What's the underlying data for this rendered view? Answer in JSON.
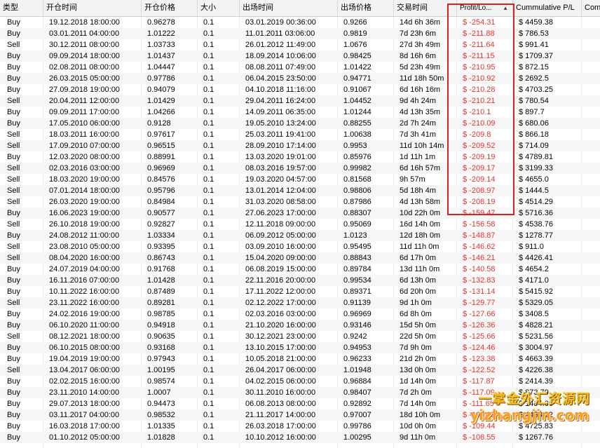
{
  "headers": [
    "类型",
    "开仓时间",
    "开仓价格",
    "大小",
    "出场时间",
    "出场价格",
    "交易时间",
    "Profit/Lo...",
    "Cummulative P/L",
    "Com"
  ],
  "rows": [
    [
      "Buy",
      "19.12.2018 18:00:00",
      "0.96278",
      "0.1",
      "03.01.2019 00:36:00",
      "0.9266",
      "14d 6h 36m",
      "$ -254.31",
      "$ 4459.38"
    ],
    [
      "Buy",
      "03.01.2011 04:00:00",
      "1.01222",
      "0.1",
      "11.01.2011 03:06:00",
      "0.9819",
      "7d 23h 6m",
      "$ -211.88",
      "$ 786.53"
    ],
    [
      "Sell",
      "30.12.2011 08:00:00",
      "1.03733",
      "0.1",
      "26.01.2012 11:49:00",
      "1.0676",
      "27d 3h 49m",
      "$ -211.64",
      "$ 991.41"
    ],
    [
      "Buy",
      "09.09.2014 18:00:00",
      "1.01437",
      "0.1",
      "18.09.2014 10:06:00",
      "0.98425",
      "8d 16h 6m",
      "$ -211.15",
      "$ 1709.37"
    ],
    [
      "Buy",
      "02.08.2011 08:00:00",
      "1.04447",
      "0.1",
      "08.08.2011 07:49:00",
      "1.01422",
      "5d 23h 49m",
      "$ -210.95",
      "$ 872.15"
    ],
    [
      "Buy",
      "26.03.2015 05:00:00",
      "0.97786",
      "0.1",
      "06.04.2015 23:50:00",
      "0.94771",
      "11d 18h 50m",
      "$ -210.92",
      "$ 2692.5"
    ],
    [
      "Buy",
      "27.09.2018 19:00:00",
      "0.94079",
      "0.1",
      "04.10.2018 11:16:00",
      "0.91067",
      "6d 16h 16m",
      "$ -210.28",
      "$ 4703.25"
    ],
    [
      "Sell",
      "20.04.2011 12:00:00",
      "1.01429",
      "0.1",
      "29.04.2011 16:24:00",
      "1.04452",
      "9d 4h 24m",
      "$ -210.21",
      "$ 780.54"
    ],
    [
      "Buy",
      "09.09.2011 17:00:00",
      "1.04266",
      "0.1",
      "14.09.2011 06:35:00",
      "1.01244",
      "4d 13h 35m",
      "$ -210.1",
      "$ 897.7"
    ],
    [
      "Buy",
      "17.05.2010 06:00:00",
      "0.9128",
      "0.1",
      "19.05.2010 13:24:00",
      "0.88255",
      "2d 7h 24m",
      "$ -210.09",
      "$ 680.06"
    ],
    [
      "Sell",
      "18.03.2011 16:00:00",
      "0.97617",
      "0.1",
      "25.03.2011 19:41:00",
      "1.00638",
      "7d 3h 41m",
      "$ -209.8",
      "$ 866.18"
    ],
    [
      "Sell",
      "17.09.2010 07:00:00",
      "0.96515",
      "0.1",
      "28.09.2010 17:14:00",
      "0.9953",
      "11d 10h 14m",
      "$ -209.52",
      "$ 714.09"
    ],
    [
      "Buy",
      "12.03.2020 08:00:00",
      "0.88991",
      "0.1",
      "13.03.2020 19:01:00",
      "0.85976",
      "1d 11h 1m",
      "$ -209.19",
      "$ 4789.81"
    ],
    [
      "Sell",
      "02.03.2016 03:00:00",
      "0.96969",
      "0.1",
      "08.03.2016 19:57:00",
      "0.99982",
      "6d 16h 57m",
      "$ -209.17",
      "$ 3199.33"
    ],
    [
      "Sell",
      "18.03.2020 19:00:00",
      "0.84576",
      "0.1",
      "19.03.2020 04:57:00",
      "0.81568",
      "9h 57m",
      "$ -209.14",
      "$ 4655.0"
    ],
    [
      "Sell",
      "07.01.2014 18:00:00",
      "0.95796",
      "0.1",
      "13.01.2014 12:04:00",
      "0.98806",
      "5d 18h 4m",
      "$ -208.97",
      "$ 1444.5"
    ],
    [
      "Sell",
      "26.03.2020 19:00:00",
      "0.84984",
      "0.1",
      "31.03.2020 08:58:00",
      "0.87986",
      "4d 13h 58m",
      "$ -208.19",
      "$ 4514.29"
    ],
    [
      "Buy",
      "16.06.2023 19:00:00",
      "0.90577",
      "0.1",
      "27.06.2023 17:00:00",
      "0.88307",
      "10d 22h 0m",
      "$ -159.47",
      "$ 5716.36"
    ],
    [
      "Sell",
      "26.10.2018 19:00:00",
      "0.92827",
      "0.1",
      "12.11.2018 09:00:00",
      "0.95069",
      "16d 14h 0m",
      "$ -156.58",
      "$ 4538.76"
    ],
    [
      "Buy",
      "24.08.2012 11:00:00",
      "1.03334",
      "0.1",
      "06.09.2012 05:00:00",
      "1.0123",
      "12d 18h 0m",
      "$ -148.87",
      "$ 1278.77"
    ],
    [
      "Sell",
      "23.08.2010 05:00:00",
      "0.93395",
      "0.1",
      "03.09.2010 16:00:00",
      "0.95495",
      "11d 11h 0m",
      "$ -146.62",
      "$ 911.0"
    ],
    [
      "Sell",
      "08.04.2020 16:00:00",
      "0.86743",
      "0.1",
      "15.04.2020 09:00:00",
      "0.88843",
      "6d 17h 0m",
      "$ -146.21",
      "$ 4426.41"
    ],
    [
      "Buy",
      "24.07.2019 04:00:00",
      "0.91768",
      "0.1",
      "06.08.2019 15:00:00",
      "0.89784",
      "13d 11h 0m",
      "$ -140.58",
      "$ 4654.2"
    ],
    [
      "Buy",
      "16.11.2016 07:00:00",
      "1.01428",
      "0.1",
      "22.11.2016 20:00:00",
      "0.99534",
      "6d 13h 0m",
      "$ -132.83",
      "$ 4171.0"
    ],
    [
      "Buy",
      "10.11.2022 16:00:00",
      "0.87489",
      "0.1",
      "17.11.2022 12:00:00",
      "0.89371",
      "6d 20h 0m",
      "$ -131.14",
      "$ 5415.92"
    ],
    [
      "Sell",
      "23.11.2022 16:00:00",
      "0.89281",
      "0.1",
      "02.12.2022 17:00:00",
      "0.91139",
      "9d 1h 0m",
      "$ -129.77",
      "$ 5329.05"
    ],
    [
      "Buy",
      "24.02.2016 19:00:00",
      "0.98785",
      "0.1",
      "02.03.2016 03:00:00",
      "0.96969",
      "6d 8h 0m",
      "$ -127.66",
      "$ 3408.5"
    ],
    [
      "Buy",
      "06.10.2020 11:00:00",
      "0.94918",
      "0.1",
      "21.10.2020 16:00:00",
      "0.93146",
      "15d 5h 0m",
      "$ -126.36",
      "$ 4828.21"
    ],
    [
      "Sell",
      "08.12.2021 18:00:00",
      "0.90635",
      "0.1",
      "30.12.2021 23:00:00",
      "0.9242",
      "22d 5h 0m",
      "$ -125.66",
      "$ 5231.56"
    ],
    [
      "Buy",
      "06.10.2015 08:00:00",
      "0.93168",
      "0.1",
      "13.10.2015 17:00:00",
      "0.94953",
      "7d 9h 0m",
      "$ -124.46",
      "$ 3004.97"
    ],
    [
      "Buy",
      "19.04.2019 19:00:00",
      "0.97943",
      "0.1",
      "10.05.2018 21:00:00",
      "0.96233",
      "21d 2h 0m",
      "$ -123.38",
      "$ 4663.39"
    ],
    [
      "Sell",
      "13.04.2017 06:00:00",
      "1.00195",
      "0.1",
      "26.04.2017 06:00:00",
      "1.01948",
      "13d 0h 0m",
      "$ -122.52",
      "$ 4226.38"
    ],
    [
      "Buy",
      "02.02.2015 16:00:00",
      "0.98574",
      "0.1",
      "04.02.2015 06:00:00",
      "0.96884",
      "1d 14h 0m",
      "$ -117.87",
      "$ 2414.39"
    ],
    [
      "Buy",
      "23.11.2010 14:00:00",
      "1.0007",
      "0.1",
      "30.11.2010 16:00:00",
      "0.98407",
      "7d 2h 0m",
      "$ -117.09",
      "$ 873.79"
    ],
    [
      "Buy",
      "29.07.2013 18:00:00",
      "0.94473",
      "0.1",
      "06.08.2013 08:00:00",
      "0.92892",
      "7d 14h 0m",
      "$ -111.65",
      "$ 1404.06"
    ],
    [
      "Buy",
      "03.11.2017 04:00:00",
      "0.98532",
      "0.1",
      "21.11.2017 14:00:00",
      "0.97007",
      "18d 10h 0m",
      "$ -109.19",
      "$ 4468.92"
    ],
    [
      "Buy",
      "16.03.2018 17:00:00",
      "1.01335",
      "0.1",
      "26.03.2018 17:00:00",
      "0.99786",
      "10d 0h 0m",
      "$ -109.44",
      "$ 4725.83"
    ],
    [
      "Buy",
      "01.10.2012 05:00:00",
      "1.01828",
      "0.1",
      "10.10.2012 16:00:00",
      "1.00295",
      "9d 11h 0m",
      "$ -108.55",
      "$ 1267.76"
    ]
  ],
  "watermark": {
    "line1": "一掌金外汇资源网",
    "line2": "yizhangjin.com"
  },
  "colors": {
    "loss": "#e8342a",
    "highlight": "#e02020",
    "header_bg": "#f3f3f3"
  },
  "sort_icon": "sort-up-icon"
}
